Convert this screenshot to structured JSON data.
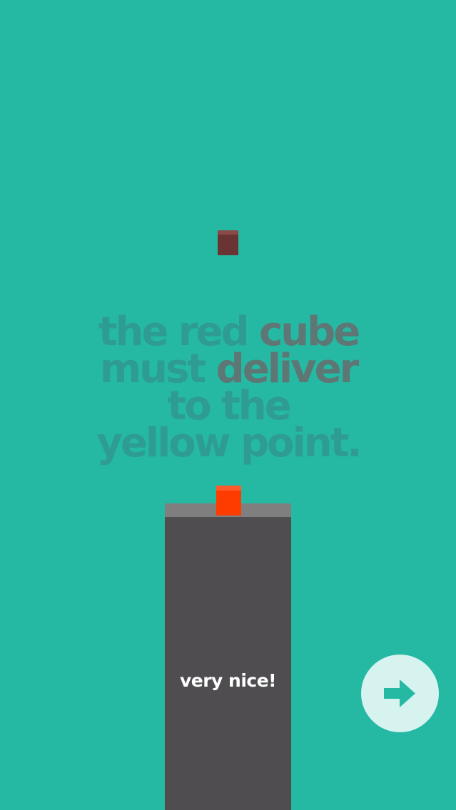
{
  "instruction": {
    "line1_muted": "the red ",
    "line1_strong": "cube",
    "line2_muted": "must ",
    "line2_strong": "deliver",
    "line3": "to the",
    "line4": "yellow point."
  },
  "feedback_text": "very nice!",
  "next_button_icon": "arrow-right-icon",
  "colors": {
    "background": "#25b9a3",
    "tower": "#4f4d4f",
    "player_cube": "#ff3c00",
    "falling_cube": "#6a3434",
    "next_button_bg": "#d6f3ef",
    "next_arrow": "#25b9a3"
  }
}
